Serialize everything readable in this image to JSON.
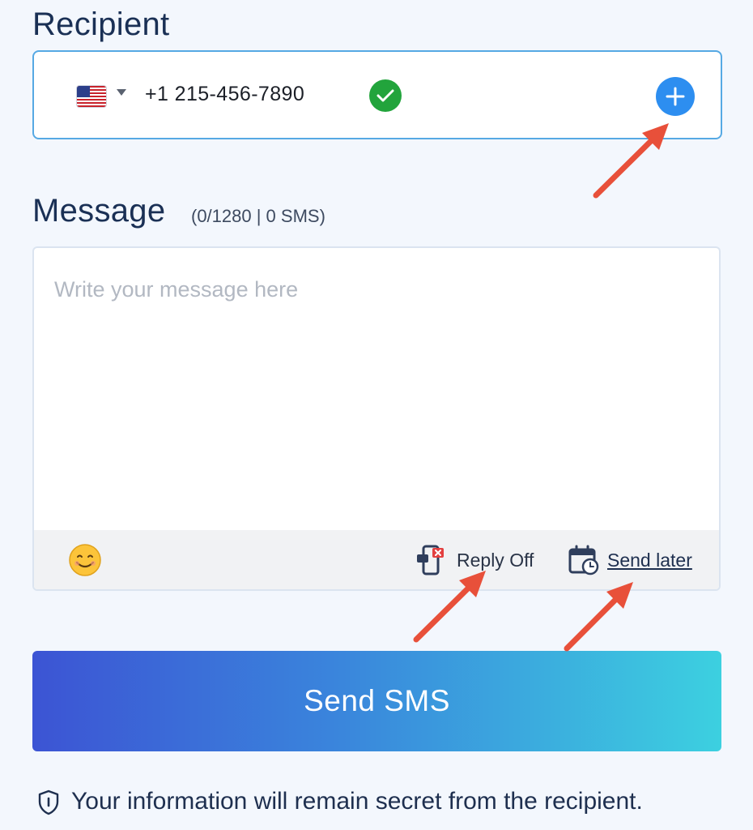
{
  "recipient": {
    "heading": "Recipient",
    "country_flag": "us-flag-icon",
    "phone_number": "+1 215-456-7890",
    "verified_icon": "check-circle-icon",
    "add_icon": "plus-circle-icon"
  },
  "message": {
    "heading": "Message",
    "counter": "(0/1280 | 0 SMS)",
    "placeholder": "Write your message here",
    "value": ""
  },
  "toolbar": {
    "emoji_icon": "smiley-icon",
    "reply_label": "Reply Off",
    "send_later_label": "Send later"
  },
  "send_button_label": "Send SMS",
  "privacy_note": "Your information will remain secret from the recipient.",
  "colors": {
    "accent_blue": "#2d8ef0",
    "verified_green": "#22a43c",
    "annotation_arrow": "#e8503a",
    "gradient_start": "#3c54d4",
    "gradient_end": "#3cd0e0"
  }
}
